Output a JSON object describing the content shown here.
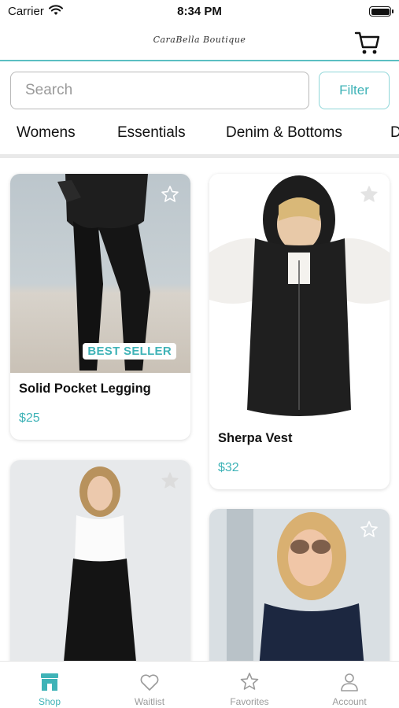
{
  "status_bar": {
    "carrier": "Carrier",
    "time": "8:34 PM"
  },
  "header": {
    "logo_text": "CaraBella Boutique",
    "cart_icon": "shopping-cart-icon"
  },
  "search": {
    "placeholder": "Search",
    "filter_label": "Filter"
  },
  "categories": [
    "Womens",
    "Essentials",
    "Denim & Bottoms",
    "D"
  ],
  "products": [
    {
      "title": "Solid Pocket Legging",
      "price": "$25",
      "badge": "BEST SELLER",
      "favorited": false
    },
    {
      "title": "Sherpa Vest",
      "price": "$32",
      "badge": "",
      "favorited": false
    },
    {
      "title": "",
      "price": "",
      "badge": "",
      "favorited": false
    },
    {
      "title": "",
      "price": "",
      "badge": "",
      "favorited": false
    }
  ],
  "tabs": [
    {
      "label": "Shop",
      "icon": "store-icon",
      "active": true
    },
    {
      "label": "Waitlist",
      "icon": "heart-icon",
      "active": false
    },
    {
      "label": "Favorites",
      "icon": "star-icon",
      "active": false
    },
    {
      "label": "Account",
      "icon": "person-icon",
      "active": false
    }
  ],
  "colors": {
    "accent": "#3fb3b7",
    "header_line": "#5bbfc2",
    "muted": "#9b9b9b"
  }
}
